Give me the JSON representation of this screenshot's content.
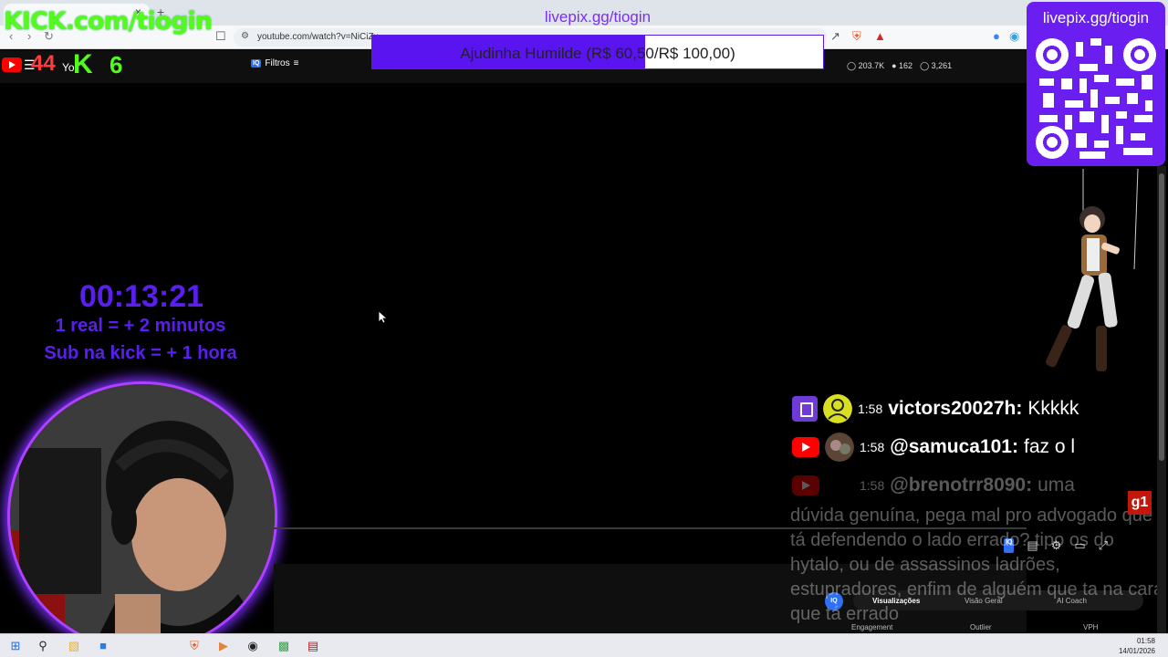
{
  "browser": {
    "url": "youtube.com/watch?v=NiCiZx",
    "back_glyph": "‹",
    "forward_glyph": "›",
    "reload_glyph": "↻",
    "close_tab_glyph": "×",
    "new_tab_glyph": "+"
  },
  "youtube": {
    "logo_text": "Yo",
    "filters_label": "Filtros",
    "iq_label": "IQ",
    "stats": [
      "203.7K",
      "162",
      "3,261"
    ]
  },
  "overlay": {
    "livepix_title": "livepix.gg/tiogin",
    "kick_logo": "KICK.com/tiogin",
    "kick_counter": "44",
    "kick_k": "K",
    "kick_six": "6",
    "goal": {
      "text": "Ajudinha Humilde (R$ 60,50/R$ 100,00)",
      "current": 60.5,
      "target": 100
    },
    "qr_title": "livepix.gg/tiogin",
    "timer": "00:13:21",
    "rule1": "1 real = + 2 minutos",
    "rule2": "Sub na kick = + 1 hora",
    "accent_color": "#5a1ff0",
    "kick_color": "#53fc18"
  },
  "chat": [
    {
      "platform": "twitch",
      "time": "1:58",
      "user": "victors20027h:",
      "text": "Kkkkk"
    },
    {
      "platform": "youtube",
      "time": "1:58",
      "user": "@samuca101:",
      "text": "faz o l"
    },
    {
      "platform": "youtube",
      "time": "1:58",
      "user": "@brenotrr8090:",
      "text": "uma",
      "continuation": "dúvida genuína, pega mal pro advogado que tá defendendo o lado errado? tipo os do hytalo, ou de assassinos ladrões, estupradores, enfim de alguém que ta na cara que tá errado"
    }
  ],
  "g1_badge": "g1",
  "vidiq": {
    "round_label": "IQ",
    "tabs_top": [
      "Visualizações",
      "Visão Geral",
      "AI Coach"
    ],
    "tabs_bottom": [
      "Engagement",
      "Outlier",
      "VPH"
    ]
  },
  "taskbar": {
    "time": "01:58",
    "date": "14/01/2026"
  }
}
